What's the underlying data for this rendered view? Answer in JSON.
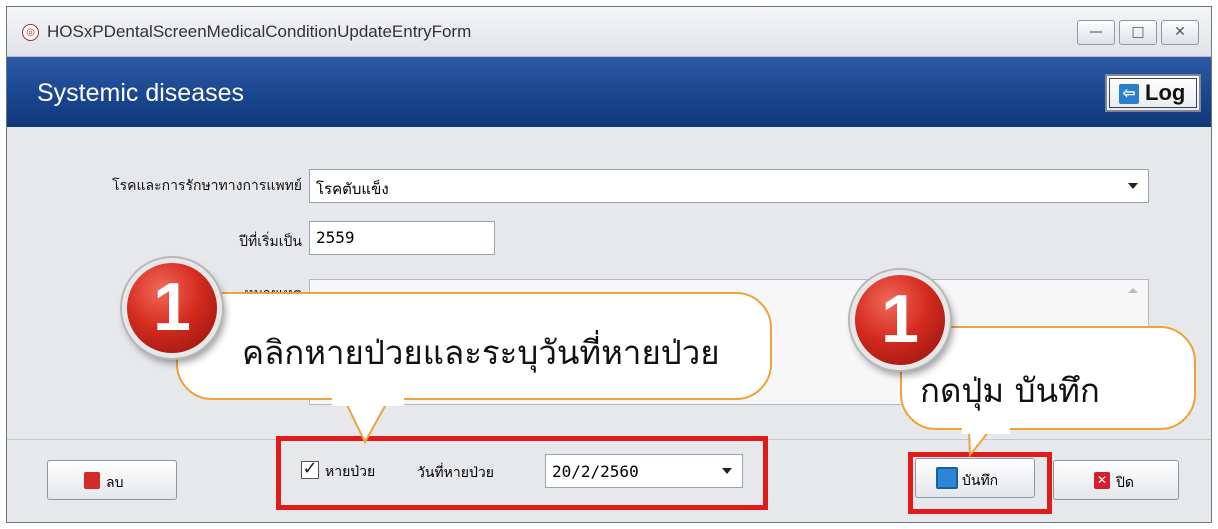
{
  "window": {
    "title": "HOSxPDentalScreenMedicalConditionUpdateEntryForm",
    "controls": {
      "minimize": "—",
      "maximize": "□",
      "close": "✕"
    }
  },
  "header": {
    "title": "Systemic diseases",
    "log_button": {
      "icon": "log-icon",
      "label": "Log"
    }
  },
  "form": {
    "disease": {
      "label": "โรคและการรักษาทางการแพทย์",
      "value": "โรคตับแข็ง"
    },
    "start_year": {
      "label": "ปีที่เริ่มเป็น",
      "value": "2559"
    },
    "note": {
      "label": "หมายเหตุ",
      "value": ""
    }
  },
  "footer": {
    "delete_button": {
      "icon": "trash-icon",
      "label": "ลบ"
    },
    "recovered": {
      "checked": true,
      "label": "หายป่วย"
    },
    "recovered_date": {
      "label": "วันที่หายป่วย",
      "value": "20/2/2560"
    },
    "save_button": {
      "icon": "save-icon",
      "label": "บันทึก"
    },
    "close_button": {
      "icon": "close-icon",
      "label": "ปิด"
    }
  },
  "annotations": [
    {
      "number": "1",
      "text": "คลิกหายป่วยและระบุวันที่หายป่วย"
    },
    {
      "number": "1",
      "text": "กดปุ่ม บันทึก"
    }
  ],
  "colors": {
    "header_blue": "#1a468f",
    "highlight_red": "#e11a1a",
    "callout_border": "#f0a23a",
    "badge_red": "#d52b1f"
  }
}
